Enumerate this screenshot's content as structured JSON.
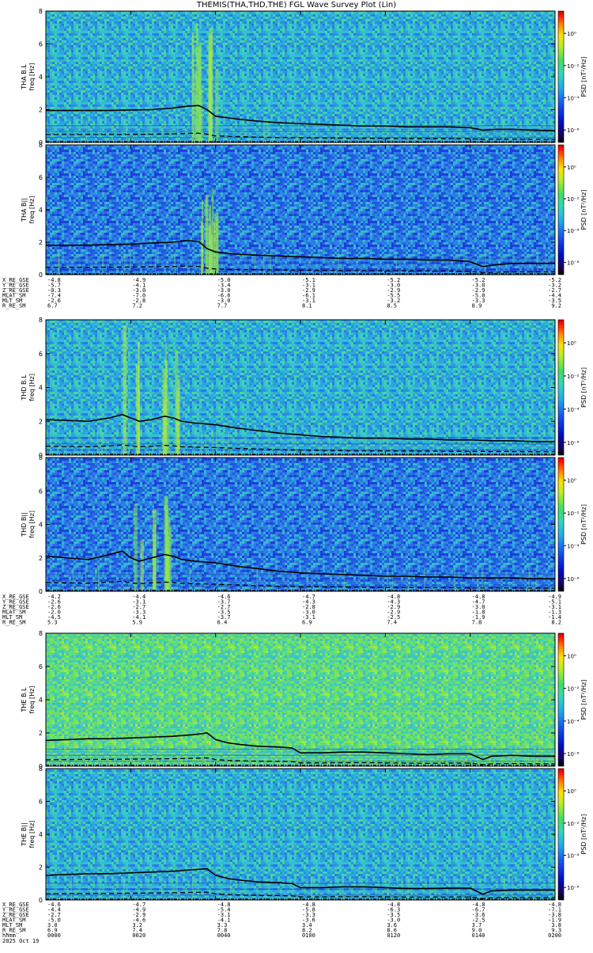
{
  "title": "THEMIS(THA,THD,THE) FGL Wave Survey Plot (Lin)",
  "colorbar_label": "PSD [nT²/Hz]",
  "colorbar_ticks": [
    "10⁰",
    "10⁻²",
    "10⁻⁴",
    "10⁻⁶"
  ],
  "ylabel": "freq [Hz]",
  "yticks": [
    0,
    2,
    4,
    6,
    8
  ],
  "ylim": [
    0,
    8
  ],
  "xlim_minutes": [
    0,
    120
  ],
  "time_ticks": [
    "0000",
    "0020",
    "0040",
    "0100",
    "0120",
    "0140",
    "0200"
  ],
  "time_label": "hhmm",
  "date_label": "2025 Oct 19",
  "colors": {
    "background": "#33a6d9",
    "line": "#000000"
  },
  "chart_data": [
    {
      "type": "heatmap",
      "probe": "THA",
      "panels": [
        {
          "name": "THA B.L",
          "power_level": "medium",
          "trace": {
            "minutes": [
              0,
              5,
              10,
              15,
              20,
              25,
              30,
              33,
              36,
              38,
              40,
              43,
              46,
              50,
              55,
              60,
              65,
              70,
              75,
              80,
              85,
              90,
              95,
              100,
              103,
              106,
              110,
              115,
              120
            ],
            "freq_hz": [
              1.95,
              1.95,
              1.95,
              1.95,
              1.98,
              2.0,
              2.1,
              2.2,
              2.25,
              2.0,
              1.6,
              1.5,
              1.4,
              1.3,
              1.2,
              1.15,
              1.1,
              1.05,
              1.0,
              1.0,
              0.95,
              0.95,
              0.95,
              0.9,
              0.75,
              0.8,
              0.8,
              0.75,
              0.72
            ]
          },
          "bursts": [
            {
              "from_min": 34,
              "to_min": 40,
              "top_hz": 8
            }
          ]
        },
        {
          "name": "THA B||",
          "power_level": "low",
          "trace": {
            "minutes": [
              0,
              5,
              10,
              15,
              20,
              25,
              30,
              33,
              36,
              38,
              40,
              43,
              46,
              50,
              55,
              60,
              65,
              70,
              75,
              80,
              85,
              90,
              95,
              100,
              103,
              106,
              110,
              115,
              120
            ],
            "freq_hz": [
              1.8,
              1.8,
              1.82,
              1.85,
              1.88,
              1.95,
              2.0,
              2.1,
              2.05,
              1.6,
              1.4,
              1.3,
              1.25,
              1.2,
              1.15,
              1.1,
              1.05,
              1.0,
              1.0,
              0.95,
              0.95,
              0.9,
              0.9,
              0.8,
              0.5,
              0.6,
              0.7,
              0.7,
              0.7
            ]
          },
          "bursts": [
            {
              "from_min": 36,
              "to_min": 40,
              "top_hz": 6
            }
          ]
        }
      ],
      "ephemeris": {
        "labels": [
          "X_RE_GSE",
          "Y_RE_GSE",
          "Z_RE_GSE",
          "MLAT_SM",
          "MLT_SM",
          "R_RE_SM"
        ],
        "values": [
          [
            "-4.8",
            "-4.9",
            "-5.0",
            "-5.1",
            "-5.2",
            "-5.2",
            "-5.2"
          ],
          [
            "-5.7",
            "-4.1",
            "-3.4",
            "-3.1",
            "-3.0",
            "-3.0",
            "-3.2"
          ],
          [
            "-0.3",
            "-3.0",
            "-3.0",
            "-2.9",
            "-2.9",
            "-2.9",
            "-2.7"
          ],
          [
            "-7.4",
            "-7.0",
            "-6.6",
            "-6.1",
            "-5.5",
            "-5.0",
            "-4.4"
          ],
          [
            "-2.6",
            "-2.8",
            "-3.0",
            "-3.1",
            "-3.2",
            "-3.3",
            "-3.5"
          ],
          [
            "6.7",
            "7.2",
            "7.7",
            "8.1",
            "8.5",
            "8.9",
            "9.2"
          ]
        ]
      }
    },
    {
      "type": "heatmap",
      "probe": "THD",
      "panels": [
        {
          "name": "THD B.L",
          "power_level": "medium",
          "trace": {
            "minutes": [
              0,
              5,
              10,
              15,
              18,
              20,
              22,
              25,
              28,
              30,
              32,
              35,
              40,
              45,
              50,
              55,
              60,
              65,
              70,
              75,
              80,
              85,
              90,
              95,
              100,
              105,
              110,
              115,
              120
            ],
            "freq_hz": [
              2.1,
              2.05,
              2.0,
              2.2,
              2.4,
              2.2,
              2.0,
              2.1,
              2.3,
              2.2,
              2.0,
              1.9,
              1.8,
              1.6,
              1.45,
              1.3,
              1.2,
              1.1,
              1.05,
              1.0,
              1.0,
              0.95,
              0.95,
              0.9,
              0.9,
              0.85,
              0.85,
              0.8,
              0.8
            ]
          },
          "bursts": [
            {
              "from_min": 18,
              "to_min": 32,
              "top_hz": 8
            }
          ]
        },
        {
          "name": "THD B||",
          "power_level": "low",
          "trace": {
            "minutes": [
              0,
              5,
              10,
              15,
              18,
              20,
              22,
              25,
              28,
              30,
              32,
              35,
              40,
              45,
              50,
              55,
              60,
              65,
              70,
              75,
              80,
              85,
              90,
              95,
              100,
              105,
              110,
              115,
              120
            ],
            "freq_hz": [
              2.1,
              2.0,
              1.9,
              2.2,
              2.4,
              2.0,
              1.8,
              2.0,
              2.2,
              2.1,
              1.9,
              1.8,
              1.7,
              1.5,
              1.35,
              1.2,
              1.1,
              1.05,
              1.0,
              0.95,
              0.9,
              0.9,
              0.85,
              0.85,
              0.8,
              0.8,
              0.8,
              0.75,
              0.75
            ]
          },
          "bursts": [
            {
              "from_min": 20,
              "to_min": 30,
              "top_hz": 6
            }
          ]
        }
      ],
      "ephemeris": {
        "labels": [
          "X_RE_GSE",
          "Y_RE_GSE",
          "Z_RE_GSE",
          "MLAT_SM",
          "MLT_SM",
          "R_RE_SM"
        ],
        "values": [
          [
            "-4.2",
            "-4.4",
            "-4.6",
            "-4.7",
            "-4.8",
            "-4.8",
            "-4.9"
          ],
          [
            "-2.6",
            "-3.1",
            "-3.7",
            "-4.3",
            "-4.3",
            "-4.7",
            "-5.1"
          ],
          [
            "-2.6",
            "-2.7",
            "-2.7",
            "-2.8",
            "-2.9",
            "-3.0",
            "-3.1"
          ],
          [
            "-2.0",
            "-3.3",
            "-3.5",
            "-3.0",
            "-2.9",
            "-1.8",
            "-1.3"
          ],
          [
            "-4.5",
            "-4.1",
            "-3.7",
            "-3.1",
            "-2.5",
            "-1.9",
            "-1.4"
          ],
          [
            "5.3",
            "5.9",
            "6.4",
            "6.9",
            "7.4",
            "7.8",
            "8.2"
          ]
        ]
      }
    },
    {
      "type": "heatmap",
      "probe": "THE",
      "panels": [
        {
          "name": "THE B.L",
          "power_level": "high",
          "trace": {
            "minutes": [
              0,
              5,
              10,
              15,
              20,
              25,
              30,
              35,
              38,
              40,
              43,
              46,
              50,
              55,
              58,
              60,
              65,
              70,
              75,
              80,
              85,
              90,
              95,
              100,
              103,
              105,
              110,
              115,
              120
            ],
            "freq_hz": [
              1.55,
              1.6,
              1.65,
              1.65,
              1.7,
              1.75,
              1.8,
              1.9,
              2.0,
              1.6,
              1.4,
              1.3,
              1.2,
              1.15,
              1.1,
              0.8,
              0.8,
              0.85,
              0.85,
              0.8,
              0.75,
              0.7,
              0.75,
              0.75,
              0.4,
              0.6,
              0.65,
              0.6,
              0.6
            ]
          },
          "bursts": []
        },
        {
          "name": "THE B||",
          "power_level": "medium",
          "trace": {
            "minutes": [
              0,
              5,
              10,
              15,
              20,
              25,
              30,
              35,
              38,
              40,
              43,
              46,
              50,
              55,
              58,
              60,
              65,
              70,
              75,
              80,
              85,
              90,
              95,
              100,
              103,
              105,
              110,
              115,
              120
            ],
            "freq_hz": [
              1.5,
              1.55,
              1.6,
              1.6,
              1.65,
              1.7,
              1.75,
              1.85,
              1.9,
              1.5,
              1.3,
              1.2,
              1.1,
              1.05,
              1.0,
              0.75,
              0.75,
              0.8,
              0.8,
              0.75,
              0.7,
              0.7,
              0.72,
              0.72,
              0.35,
              0.55,
              0.6,
              0.6,
              0.6
            ]
          },
          "bursts": []
        }
      ],
      "ephemeris": {
        "labels": [
          "X_RE_GSE",
          "Y_RE_GSE",
          "Z_RE_GSE",
          "MLAT_SM",
          "MLT_SM",
          "R_RE_SM"
        ],
        "values": [
          [
            "-4.6",
            "-4.7",
            "-4.8",
            "-4.8",
            "-4.8",
            "-4.8",
            "-4.8"
          ],
          [
            "-4.4",
            "-4.9",
            "-5.4",
            "-5.8",
            "-6.3",
            "-6.7",
            "-7.1"
          ],
          [
            "-2.7",
            "-2.9",
            "-3.1",
            "-3.3",
            "-3.5",
            "-3.6",
            "-3.8"
          ],
          [
            "-5.0",
            "-4.6",
            "-4.1",
            "-3.6",
            "-3.0",
            "-2.5",
            "-1.9"
          ],
          [
            "3.0",
            "3.2",
            "3.3",
            "3.4",
            "3.6",
            "3.7",
            "3.8"
          ],
          [
            "6.9",
            "7.4",
            "7.8",
            "8.2",
            "8.6",
            "9.0",
            "9.3"
          ]
        ]
      }
    }
  ]
}
